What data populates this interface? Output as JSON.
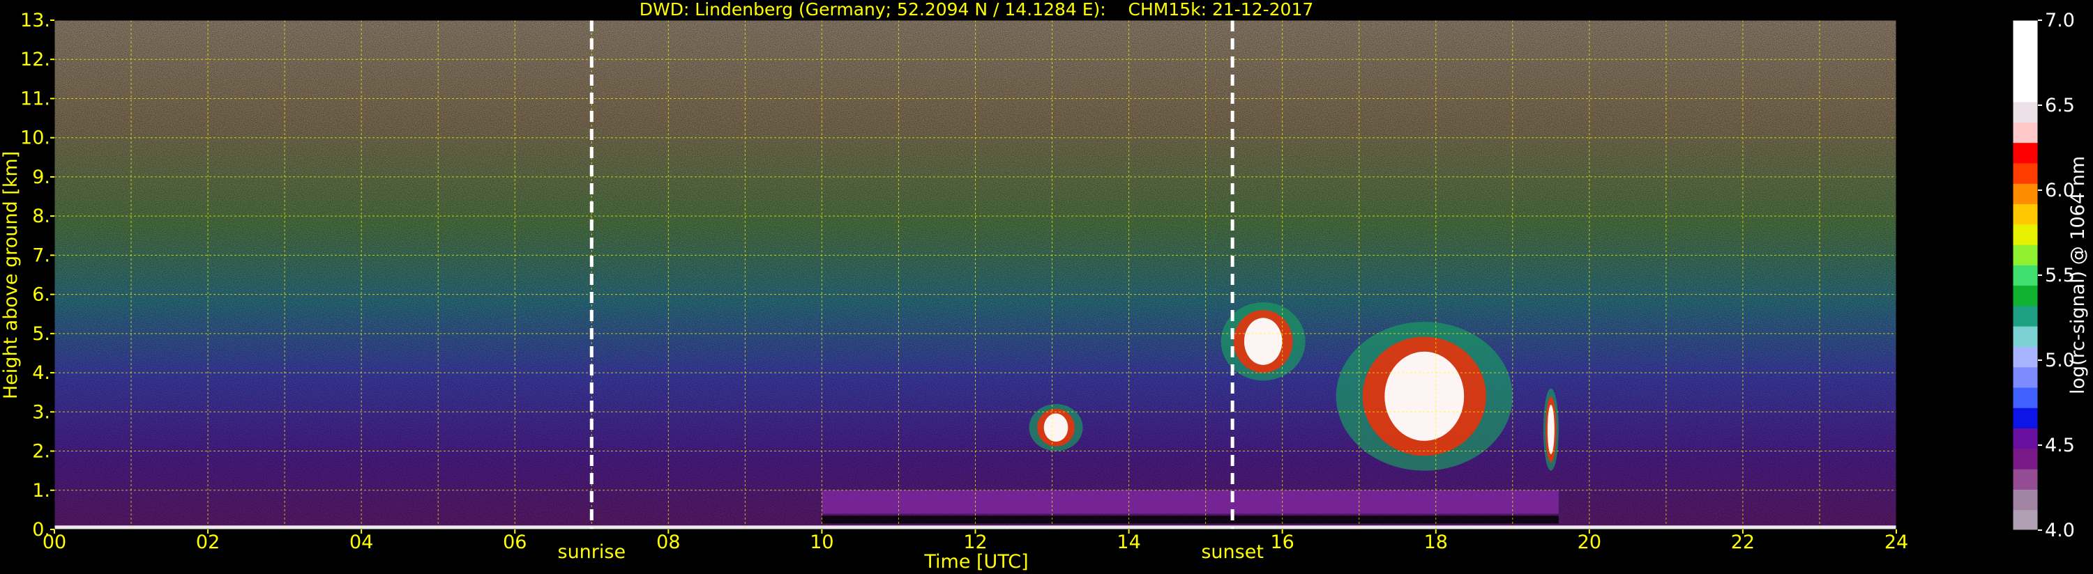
{
  "colors": {
    "background": "#000000",
    "text_yellow": "#ffff00",
    "grid_yellow": "#ffff00",
    "marker_white": "#ffffff"
  },
  "chart_data": {
    "type": "heatmap",
    "title": "DWD: Lindenberg (Germany; 52.2094 N / 14.1284 E):    CHM15k: 21-12-2017",
    "xlabel": "Time [UTC]",
    "ylabel": "Height above ground [km]",
    "xlim": [
      0,
      24
    ],
    "ylim": [
      0,
      13
    ],
    "xticks": [
      "00",
      "02",
      "04",
      "06",
      "08",
      "10",
      "12",
      "14",
      "16",
      "18",
      "20",
      "22",
      "24"
    ],
    "yticks": [
      "0.",
      "1.",
      "2.",
      "3.",
      "4.",
      "5.",
      "6.",
      "7.",
      "8.",
      "9.",
      "10.",
      "11.",
      "12.",
      "13."
    ],
    "grid": true,
    "vertical_markers": [
      {
        "label": "sunrise",
        "x": 7.0
      },
      {
        "label": "sunset",
        "x": 15.35
      }
    ],
    "colorbar": {
      "label": "log(rc-signal) @ 1064 nm",
      "range": [
        4.0,
        7.0
      ],
      "ticks": [
        "4.0",
        "4.5",
        "5.0",
        "5.5",
        "6.0",
        "6.5",
        "7.0"
      ],
      "colors": [
        "#b0a0b4",
        "#a184a4",
        "#944c94",
        "#7a1a88",
        "#6a10a0",
        "#0c14e6",
        "#4060ff",
        "#7c8cff",
        "#a8b4ff",
        "#7cd2d2",
        "#1ea082",
        "#10b030",
        "#40e070",
        "#90f030",
        "#e6f000",
        "#ffc800",
        "#ff8c00",
        "#ff3c00",
        "#ff0000",
        "#ffc8c8",
        "#ebe0e6",
        "#ffffff",
        "#ffffff",
        "#ffffff",
        "#ffffff"
      ]
    },
    "features": [
      {
        "name": "surface layer",
        "x_range": [
          0,
          24
        ],
        "height_km": 0.1
      },
      {
        "name": "boundary layer aerosol",
        "x_range": [
          10,
          19.6
        ],
        "height_range_km": [
          0.4,
          1.0
        ]
      },
      {
        "name": "cloud",
        "x_range": [
          12.7,
          13.4
        ],
        "height_range_km": [
          2.0,
          3.2
        ]
      },
      {
        "name": "cloud",
        "x_range": [
          15.2,
          16.3
        ],
        "height_range_km": [
          3.8,
          5.8
        ]
      },
      {
        "name": "cloud",
        "x_range": [
          16.7,
          19.0
        ],
        "height_range_km": [
          1.5,
          5.3
        ]
      },
      {
        "name": "cloud",
        "x_range": [
          19.4,
          19.6
        ],
        "height_range_km": [
          1.5,
          3.6
        ]
      }
    ]
  }
}
